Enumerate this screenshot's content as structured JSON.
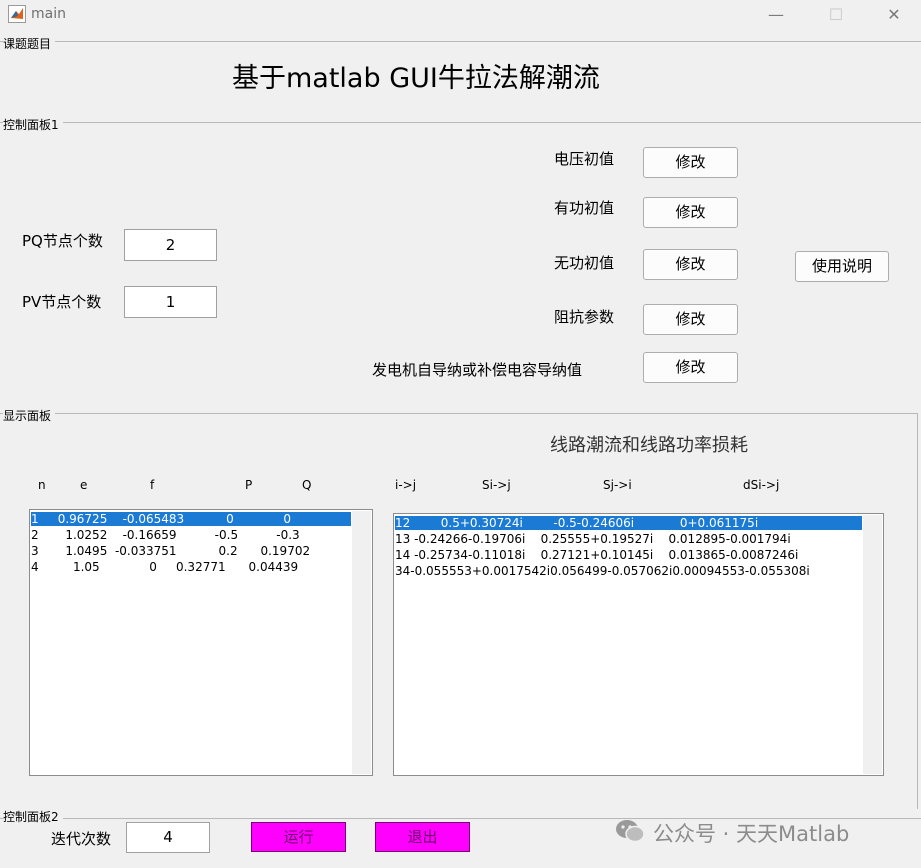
{
  "window": {
    "title": "main",
    "minimize": "—",
    "maximize": "☐",
    "close": "✕"
  },
  "panel_topic": {
    "label": "课题题目",
    "title": "基于matlab GUI牛拉法解潮流"
  },
  "panel_control1": {
    "label": "控制面板1",
    "pq_label": "PQ节点个数",
    "pq_value": "2",
    "pv_label": "PV节点个数",
    "pv_value": "1",
    "voltage_label": "电压初值",
    "active_label": "有功初值",
    "reactive_label": "无功初值",
    "impedance_label": "阻抗参数",
    "generator_label": "发电机自导纳或补偿电容导纳值",
    "modify_label": "修改",
    "help_button": "使用说明"
  },
  "panel_display": {
    "label": "显示面板",
    "subtitle": "线路潮流和线路功率损耗",
    "node_headers": [
      "n",
      "e",
      "f",
      "P",
      "Q"
    ],
    "node_rows": [
      "1     0.96725    -0.065483           0             0",
      "2       1.0252    -0.16659          -0.5          -0.3",
      "3       1.0495  -0.033751           0.2      0.19702",
      "4         1.05             0     0.32771      0.04439"
    ],
    "line_headers": [
      "i->j",
      "Si->j",
      "Sj->i",
      "dSi->j"
    ],
    "line_rows": [
      "12        0.5+0.30724i        -0.5-0.24606i            0+0.061175i",
      "13 -0.24266-0.19706i    0.25555+0.19527i    0.012895-0.001794i",
      "14 -0.25734-0.11018i    0.27121+0.10145i    0.013865-0.0087246i",
      "34-0.055553+0.0017542i0.056499-0.057062i0.00094553-0.055308i"
    ]
  },
  "panel_control2": {
    "label": "控制面板2",
    "iter_label": "迭代次数",
    "iter_value": "4",
    "run_button": "运行",
    "exit_button": "退出"
  },
  "watermark": {
    "text": "公众号 · 天天Matlab"
  }
}
